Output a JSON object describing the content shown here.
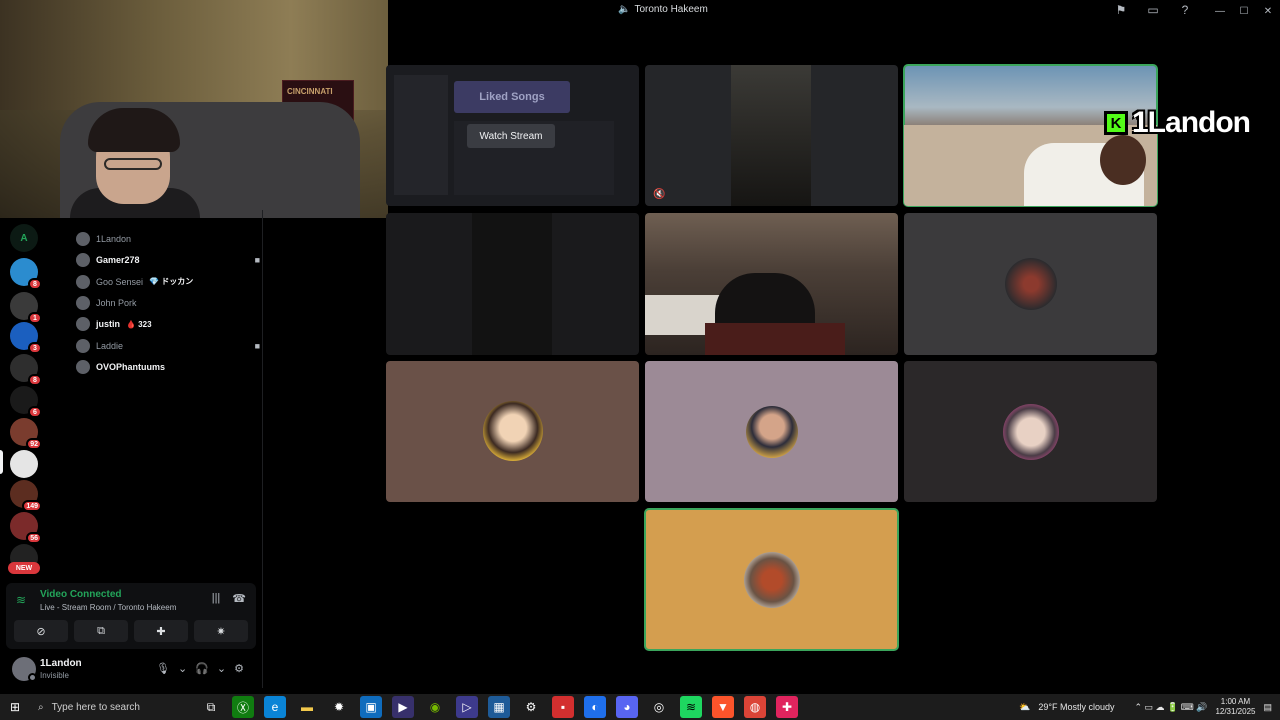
{
  "window": {
    "title": "Toronto Hakeem",
    "speaker_glyph": "🔈",
    "minimize": "—",
    "maximize": "☐",
    "close": "✕"
  },
  "title_icons": {
    "inbox": "⚑",
    "screen": "▭",
    "help": "?"
  },
  "webcam": {
    "poster_text": "CINCINNATI"
  },
  "servers": [
    {
      "letter": "A",
      "color": "#0c1a14",
      "fg": "#23a55a",
      "badge": ""
    },
    {
      "letter": "",
      "color": "#2b8ccf",
      "badge": "8"
    },
    {
      "letter": "",
      "color": "#3a3a3a",
      "badge": "1"
    },
    {
      "letter": "",
      "color": "#1b5fbf",
      "badge": "3"
    },
    {
      "letter": "",
      "color": "#2e2e2e",
      "badge": "8"
    },
    {
      "letter": "",
      "color": "#1a1a1a",
      "badge": "6"
    },
    {
      "letter": "",
      "color": "#7a3c2e",
      "badge": "92"
    },
    {
      "letter": "",
      "color": "#e5e5e5",
      "badge": ""
    },
    {
      "letter": "",
      "color": "#5c2d20",
      "badge": "149"
    },
    {
      "letter": "",
      "color": "#7b2a2a",
      "badge": "56"
    },
    {
      "letter": "",
      "color": "#222",
      "badge": ""
    }
  ],
  "new_label": "NEW",
  "members": [
    {
      "name": "1Landon",
      "active": false,
      "tag": "",
      "cam": false
    },
    {
      "name": "Gamer278",
      "active": true,
      "tag": "",
      "cam": true
    },
    {
      "name": "Goo Sensei",
      "active": false,
      "tag": "💎 ドッカン",
      "cam": false
    },
    {
      "name": "John Pork",
      "active": false,
      "tag": "",
      "cam": false
    },
    {
      "name": "justin",
      "active": true,
      "tag": "🩸 323",
      "cam": false
    },
    {
      "name": "Laddie",
      "active": false,
      "tag": "",
      "cam": true
    },
    {
      "name": "OVOPhantuums",
      "active": true,
      "tag": "",
      "cam": false
    }
  ],
  "member_cam_glyph": "■",
  "voice": {
    "status": "Video Connected",
    "channel": "Live - Stream Room / Toronto Hakeem",
    "signal_glyph": "≋",
    "noise_glyph": "|||",
    "disconnect_glyph": "☎",
    "buttons": [
      "⊘",
      "⧉",
      "✚",
      "✷"
    ]
  },
  "user": {
    "name": "1Landon",
    "status": "Invisible",
    "mic_glyph": "🎙",
    "headset_glyph": "🎧",
    "settings_glyph": "⚙",
    "caret": "⌄"
  },
  "stream": {
    "liked_songs": "Liked Songs",
    "watch_label": "Watch Stream",
    "mute_glyph": "🔇"
  },
  "overlay": {
    "logo": "K",
    "name": "1Landon"
  },
  "taskbar": {
    "start_glyph": "⊞",
    "search_glyph": "⌕",
    "search_placeholder": "Type here to search",
    "apps": [
      {
        "name": "task-view",
        "glyph": "⧉",
        "color": "#fff",
        "bg": "transparent"
      },
      {
        "name": "xbox",
        "glyph": "Ⓧ",
        "color": "#fff",
        "bg": "#107c10"
      },
      {
        "name": "edge",
        "glyph": "e",
        "color": "#fff",
        "bg": "#0a84d6"
      },
      {
        "name": "explorer",
        "glyph": "▬",
        "color": "#f2c94c",
        "bg": "transparent"
      },
      {
        "name": "settings",
        "glyph": "✹",
        "color": "#fff",
        "bg": "transparent"
      },
      {
        "name": "store",
        "glyph": "▣",
        "color": "#fff",
        "bg": "#0f6cbd"
      },
      {
        "name": "media",
        "glyph": "▶",
        "color": "#fff",
        "bg": "#37306b"
      },
      {
        "name": "nvidia",
        "glyph": "◉",
        "color": "#76b900",
        "bg": "transparent"
      },
      {
        "name": "player",
        "glyph": "▷",
        "color": "#fff",
        "bg": "#3d3a8c"
      },
      {
        "name": "calculator",
        "glyph": "▦",
        "color": "#fff",
        "bg": "#1e5b98"
      },
      {
        "name": "gear",
        "glyph": "⚙",
        "color": "#fff",
        "bg": "transparent"
      },
      {
        "name": "red-app",
        "glyph": "▪",
        "color": "#fff",
        "bg": "#d32f2f"
      },
      {
        "name": "browser",
        "glyph": "◐",
        "color": "#fff",
        "bg": "#1f6feb"
      },
      {
        "name": "discord",
        "glyph": "◕",
        "color": "#fff",
        "bg": "#5865f2"
      },
      {
        "name": "obs",
        "glyph": "◎",
        "color": "#fff",
        "bg": "transparent"
      },
      {
        "name": "spotify",
        "glyph": "≋",
        "color": "#000",
        "bg": "#1ed760"
      },
      {
        "name": "brave",
        "glyph": "▼",
        "color": "#fff",
        "bg": "#fb542b"
      },
      {
        "name": "chrome",
        "glyph": "◍",
        "color": "#fff",
        "bg": "#db4437"
      },
      {
        "name": "pin-app",
        "glyph": "✚",
        "color": "#fff",
        "bg": "#e0245e"
      }
    ],
    "weather_glyph": "⛅",
    "weather": "29°F  Mostly cloudy",
    "tray_glyphs": "⌃ ▭ ☁ 🔋 ⌨ 🔊",
    "time": "1:00 AM",
    "date": "12/31/2025",
    "notif_glyph": "▤"
  },
  "colors": {
    "accent_green": "#23a55a",
    "speaking_outline": "#3ba55c",
    "badge_red": "#da373c",
    "tile_brown": "#6a5148",
    "tile_mauve": "#9c8a96",
    "tile_orange": "#d49e4f"
  }
}
